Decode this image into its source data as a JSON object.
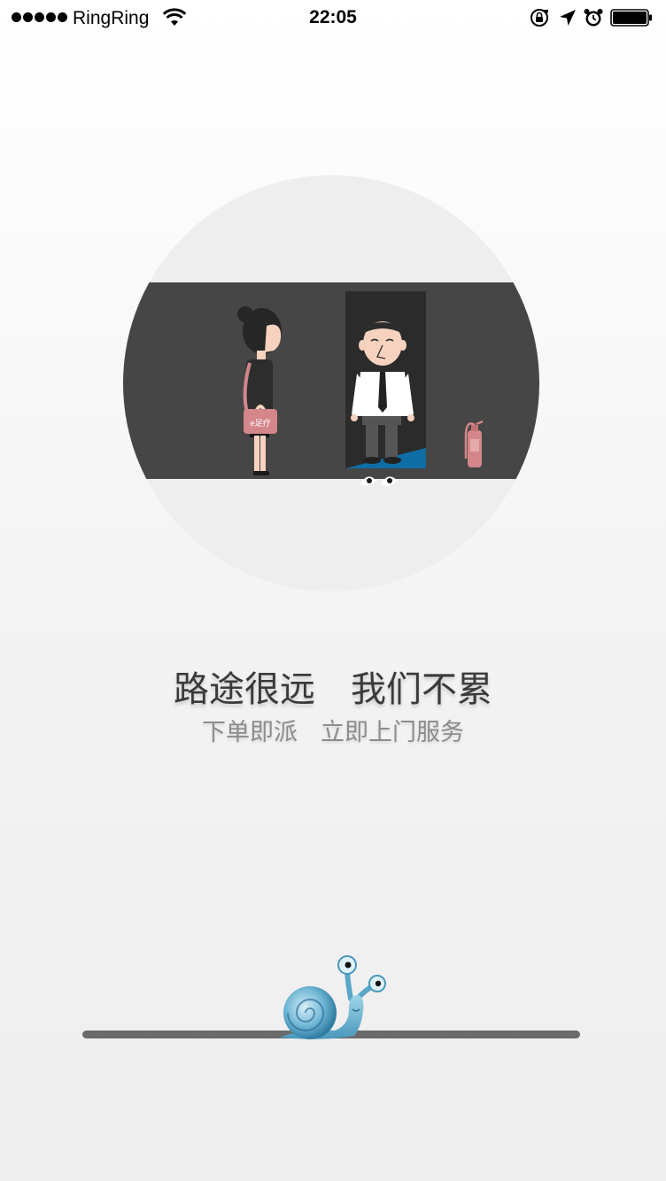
{
  "status_bar": {
    "carrier": "RingRing",
    "time": "22:05",
    "icons": [
      "signal-dots-icon",
      "wifi-icon",
      "rotation-lock-icon",
      "location-arrow-icon",
      "alarm-clock-icon",
      "battery-icon"
    ]
  },
  "illustration": {
    "bag_label": "e足疗",
    "icons": [
      "woman-figure",
      "man-in-doorway-figure",
      "fire-extinguisher-icon",
      "peeking-eyes-icon"
    ]
  },
  "slogan": {
    "main_left": "路途很远",
    "main_right": "我们不累",
    "sub_left": "下单即派",
    "sub_right": "立即上门服务"
  },
  "loading": {
    "icon": "snail-icon"
  },
  "colors": {
    "circle_bg": "#eeeeee",
    "scene_bg": "#464646",
    "accent_pink": "#d4868a",
    "floor_blue": "#0f6da6",
    "track": "#6b6b6b"
  }
}
